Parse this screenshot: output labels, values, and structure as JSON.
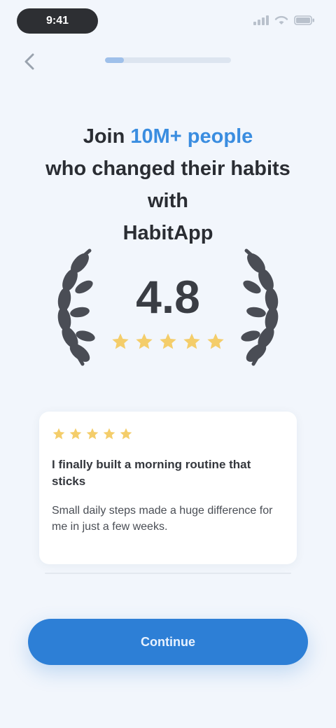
{
  "status_bar": {
    "time": "9:41"
  },
  "progress": {
    "fraction": 0.15
  },
  "headline": {
    "prefix": "Join ",
    "accent": "10M+ people",
    "rest": "who changed their habits with"
  },
  "headline_brand": "HabitApp",
  "rating": {
    "value": "4.8",
    "stars": 5
  },
  "review": {
    "stars": 5,
    "title": "I finally built a morning routine that sticks",
    "body": "Small daily steps made a huge difference for me in just a few weeks."
  },
  "cta": {
    "label": "Continue"
  },
  "colors": {
    "accent": "#3a8de0",
    "star": "#f4cd6a",
    "button": "#2d7fd6",
    "laurel": "#4a4d55"
  }
}
